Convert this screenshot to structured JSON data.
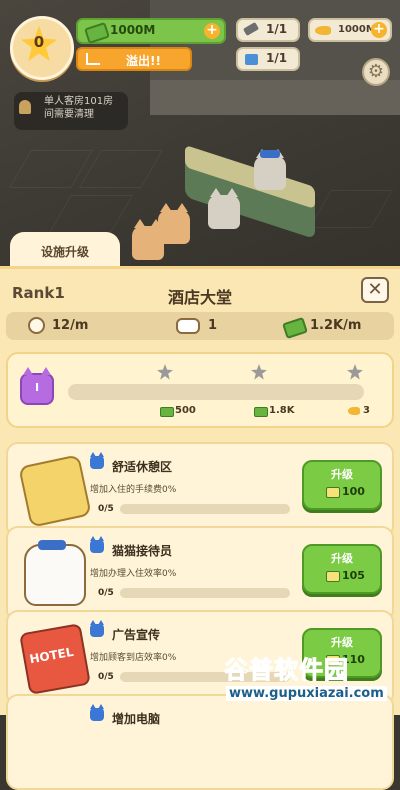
{
  "hud": {
    "stars": "0",
    "cash": "1000M",
    "overflow_label": "溢出!!",
    "staff_count": "1/1",
    "reception_count": "1/1",
    "fish": "1000M",
    "notice": "单人客房101房间需要清理"
  },
  "tab": {
    "label": "设施升级"
  },
  "panel": {
    "rank": "Rank1",
    "title": "酒店大堂",
    "stats": {
      "rate": "12/m",
      "cats": "1",
      "income": "1.2K/m"
    }
  },
  "level": {
    "badge": "I",
    "rewards": [
      "500",
      "1.8K",
      "3"
    ]
  },
  "facilities": [
    {
      "name": "舒适休憩区",
      "desc": "增加入住的手续费0%",
      "progress": "0/5",
      "btn": "升级",
      "cost": "100"
    },
    {
      "name": "猫猫接待员",
      "desc": "增加办理入住效率0%",
      "progress": "0/5",
      "btn": "升级",
      "cost": "105"
    },
    {
      "name": "广告宣传",
      "desc": "增加顾客到店效率0%",
      "progress": "0/5",
      "btn": "升级",
      "cost": "110"
    },
    {
      "name": "增加电脑",
      "desc": "",
      "progress": "",
      "btn": "",
      "cost": ""
    }
  ],
  "watermark": {
    "main": "谷普软件园",
    "sub": "www.gupuxiazai.com"
  },
  "colors": {
    "accent_green": "#7ccb45",
    "panel_bg": "#fbe7b4",
    "orange": "#f7a52c"
  }
}
